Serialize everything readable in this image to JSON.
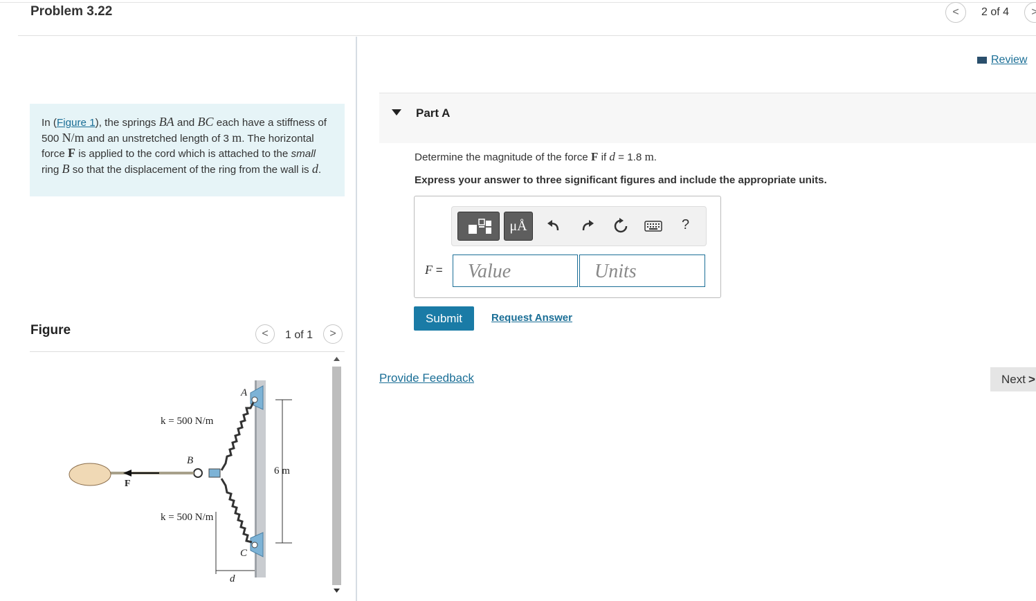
{
  "header": {
    "title": "Problem 3.22",
    "pager": "2 of 4",
    "prev_glyph": "<",
    "next_glyph": ">"
  },
  "problem": {
    "p1": "In (",
    "figure_link": "Figure 1",
    "p2": "), the springs ",
    "BA": "BA",
    "p3": " and ",
    "BC": "BC",
    "p4": " each have a stiffness of 500 ",
    "unit_Nm": "N/m",
    "p5": " and an unstretched length of 3 ",
    "unit_m": "m",
    "p6": ". The horizontal force ",
    "F": "F",
    "p7": " is applied to the cord which is attached to the ",
    "small": "small",
    "p8": " ring ",
    "B": "B",
    "p9": " so that the displacement of the ring from the wall is ",
    "d": "d",
    "p10": "."
  },
  "figure": {
    "heading": "Figure",
    "pager": "1 of 1",
    "prev_glyph": "<",
    "next_glyph": ">",
    "labels": {
      "k_top": "k = 500 N/m",
      "k_bottom": "k = 500 N/m",
      "A": "A",
      "B": "B",
      "C": "C",
      "F": "F",
      "height": "6 m",
      "d": "d"
    }
  },
  "review": "Review",
  "part": {
    "title": "Part A",
    "q1": "Determine the magnitude of the force ",
    "qF": "F",
    "q2": " if ",
    "qd": "d",
    "q3": " = 1.8 ",
    "qm": "m",
    "q4": ".",
    "instruction": "Express your answer to three significant figures and include the appropriate units.",
    "toolbar": {
      "units_symbol": "μÅ",
      "help": "?"
    },
    "input_label": "F",
    "input_eq": " =",
    "value_placeholder": "Value",
    "units_placeholder": "Units",
    "submit": "Submit",
    "request": "Request Answer"
  },
  "feedback": "Provide Feedback",
  "next": "Next"
}
